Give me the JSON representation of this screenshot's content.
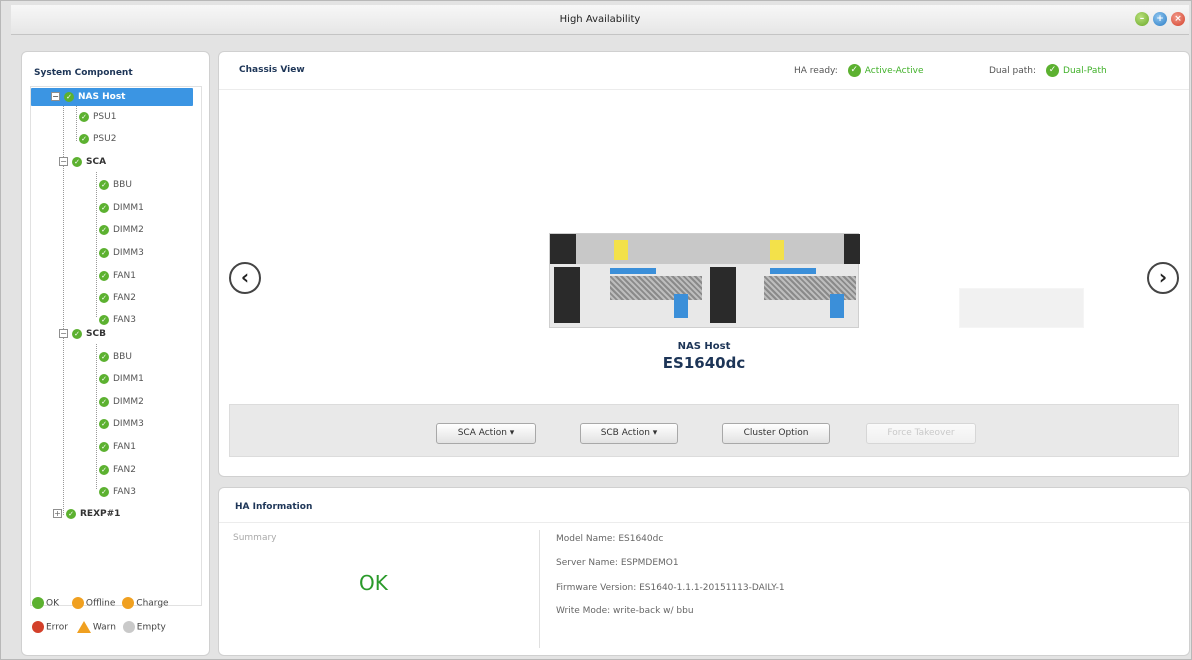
{
  "window": {
    "title": "High Availability"
  },
  "sidebar": {
    "heading": "System Component",
    "tree": {
      "nas_host": "NAS Host",
      "psu1": "PSU1",
      "psu2": "PSU2",
      "sca": "SCA",
      "sca_items": [
        "BBU",
        "DIMM1",
        "DIMM2",
        "DIMM3",
        "FAN1",
        "FAN2",
        "FAN3"
      ],
      "scb": "SCB",
      "scb_items": [
        "BBU",
        "DIMM1",
        "DIMM2",
        "DIMM3",
        "FAN1",
        "FAN2",
        "FAN3"
      ],
      "rexp": "REXP#1"
    },
    "legend": {
      "ok": "OK",
      "offline": "Offline",
      "charge": "Charge",
      "error": "Error",
      "warn": "Warn",
      "empty": "Empty"
    }
  },
  "chassis": {
    "title": "Chassis View",
    "ha_ready_label": "HA ready:",
    "ha_ready_value": "Active-Active",
    "dual_path_label": "Dual path:",
    "dual_path_value": "Dual-Path",
    "device_label": "NAS Host",
    "device_model": "ES1640dc",
    "buttons": {
      "sca_action": "SCA Action ▾",
      "scb_action": "SCB Action ▾",
      "cluster_option": "Cluster Option",
      "force_takeover": "Force Takeover"
    }
  },
  "ha_info": {
    "title": "HA Information",
    "summary_label": "Summary",
    "summary_value": "OK",
    "model_name": "Model Name: ES1640dc",
    "server_name": "Server Name: ESPMDEMO1",
    "firmware_version": "Firmware Version: ES1640-1.1.1-20151113-DAILY-1",
    "write_mode": "Write Mode: write-back w/ bbu"
  },
  "colors": {
    "ok_green": "#5cb130",
    "selection_blue": "#3b95e3",
    "title_navy": "#1d3557"
  }
}
